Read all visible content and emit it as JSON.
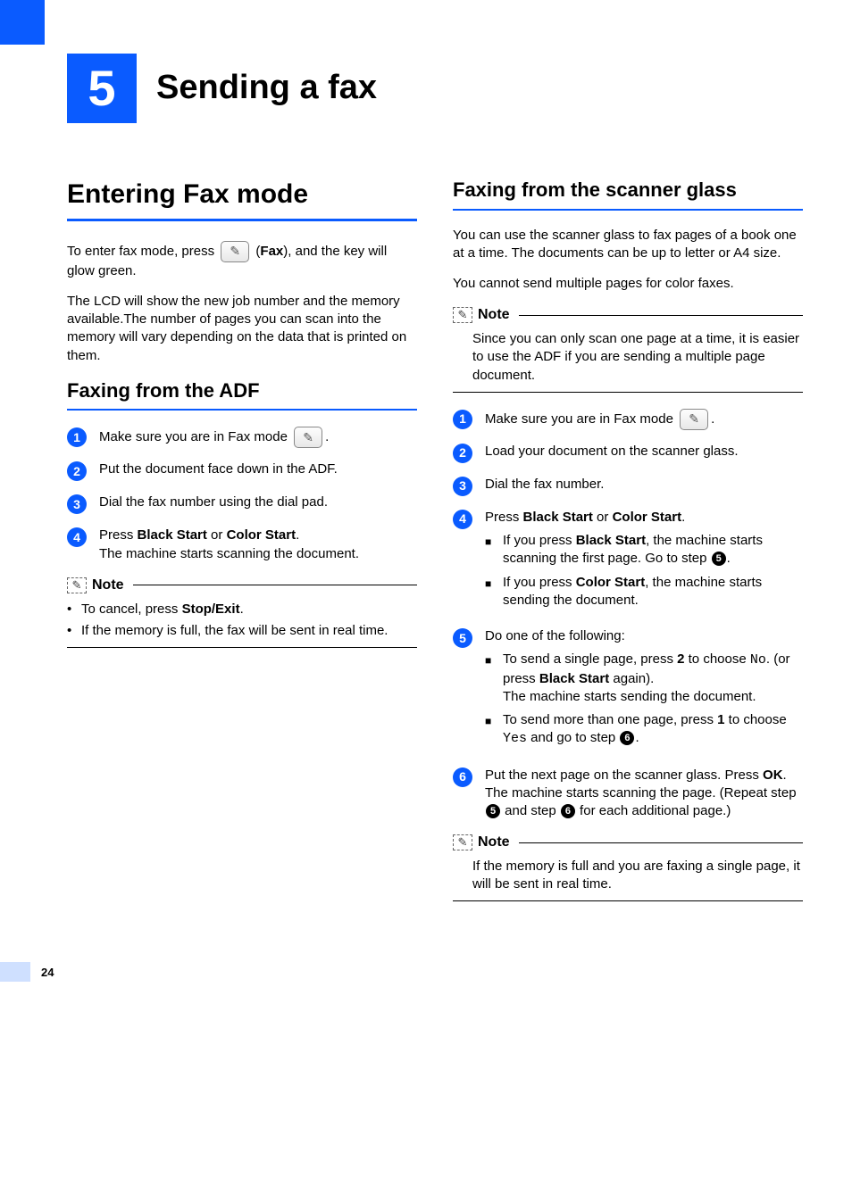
{
  "chapter": {
    "number": "5",
    "title": "Sending a fax"
  },
  "leftCol": {
    "h1": "Entering Fax mode",
    "intro1a": "To enter fax mode, press ",
    "intro1b": " (",
    "intro1c": "Fax",
    "intro1d": "), and the key will glow green.",
    "intro2": "The LCD will show the new job number and the memory available.The number of pages you can scan into the memory will vary depending on the data that is printed on them.",
    "h2": "Faxing from the ADF",
    "steps": {
      "s1a": "Make sure you are in Fax mode ",
      "s1b": ".",
      "s2": "Put the document face down in the ADF.",
      "s3": "Dial the fax number using the dial pad.",
      "s4a": "Press ",
      "s4b": "Black Start",
      "s4c": " or ",
      "s4d": "Color Start",
      "s4e": ".",
      "s4f": "The machine starts scanning the document."
    },
    "noteLabel": "Note",
    "noteItems": {
      "n1a": "To cancel, press ",
      "n1b": "Stop/Exit",
      "n1c": ".",
      "n2": "If the memory is full, the fax will be sent in real time."
    }
  },
  "rightCol": {
    "h2": "Faxing from the scanner glass",
    "p1": "You can use the scanner glass to fax pages of a book one at a time. The documents can be up to letter or A4 size.",
    "p2": "You cannot send multiple pages for color faxes.",
    "note1Label": "Note",
    "note1Body": "Since you can only scan one page at a time, it is easier to use the ADF if you are sending a multiple page document.",
    "steps": {
      "s1a": "Make sure you are in Fax mode ",
      "s1b": ".",
      "s2": "Load your document on the scanner glass.",
      "s3": "Dial the fax number.",
      "s4a": "Press ",
      "s4b": "Black Start",
      "s4c": " or ",
      "s4d": "Color Start",
      "s4e": ".",
      "s4_b1a": "If you press ",
      "s4_b1b": "Black Start",
      "s4_b1c": ", the machine starts scanning the first page. Go to step ",
      "s4_b1d": ".",
      "s4_b2a": "If you press ",
      "s4_b2b": "Color Start",
      "s4_b2c": ", the machine starts sending the document.",
      "s5a": "Do one of the following:",
      "s5_b1a": "To send a single page, press ",
      "s5_b1b": "2",
      "s5_b1c": " to choose ",
      "s5_b1d": "No",
      "s5_b1e": ". (or press ",
      "s5_b1f": "Black Start",
      "s5_b1g": " again).",
      "s5_b1h": "The machine starts sending the document.",
      "s5_b2a": "To send more than one page, press ",
      "s5_b2b": "1",
      "s5_b2c": " to choose ",
      "s5_b2d": "Yes",
      "s5_b2e": " and go to step ",
      "s5_b2f": ".",
      "s6a": "Put the next page on the scanner glass. Press ",
      "s6b": "OK",
      "s6c": ".",
      "s6d": "The machine starts scanning the page. (Repeat step ",
      "s6e": " and step ",
      "s6f": " for each additional page.)"
    },
    "note2Label": "Note",
    "note2Body": "If the memory is full and you are faxing a single page, it will be sent in real time.",
    "inlineRefs": {
      "r5": "5",
      "r6": "6"
    }
  },
  "pageNumber": "24"
}
